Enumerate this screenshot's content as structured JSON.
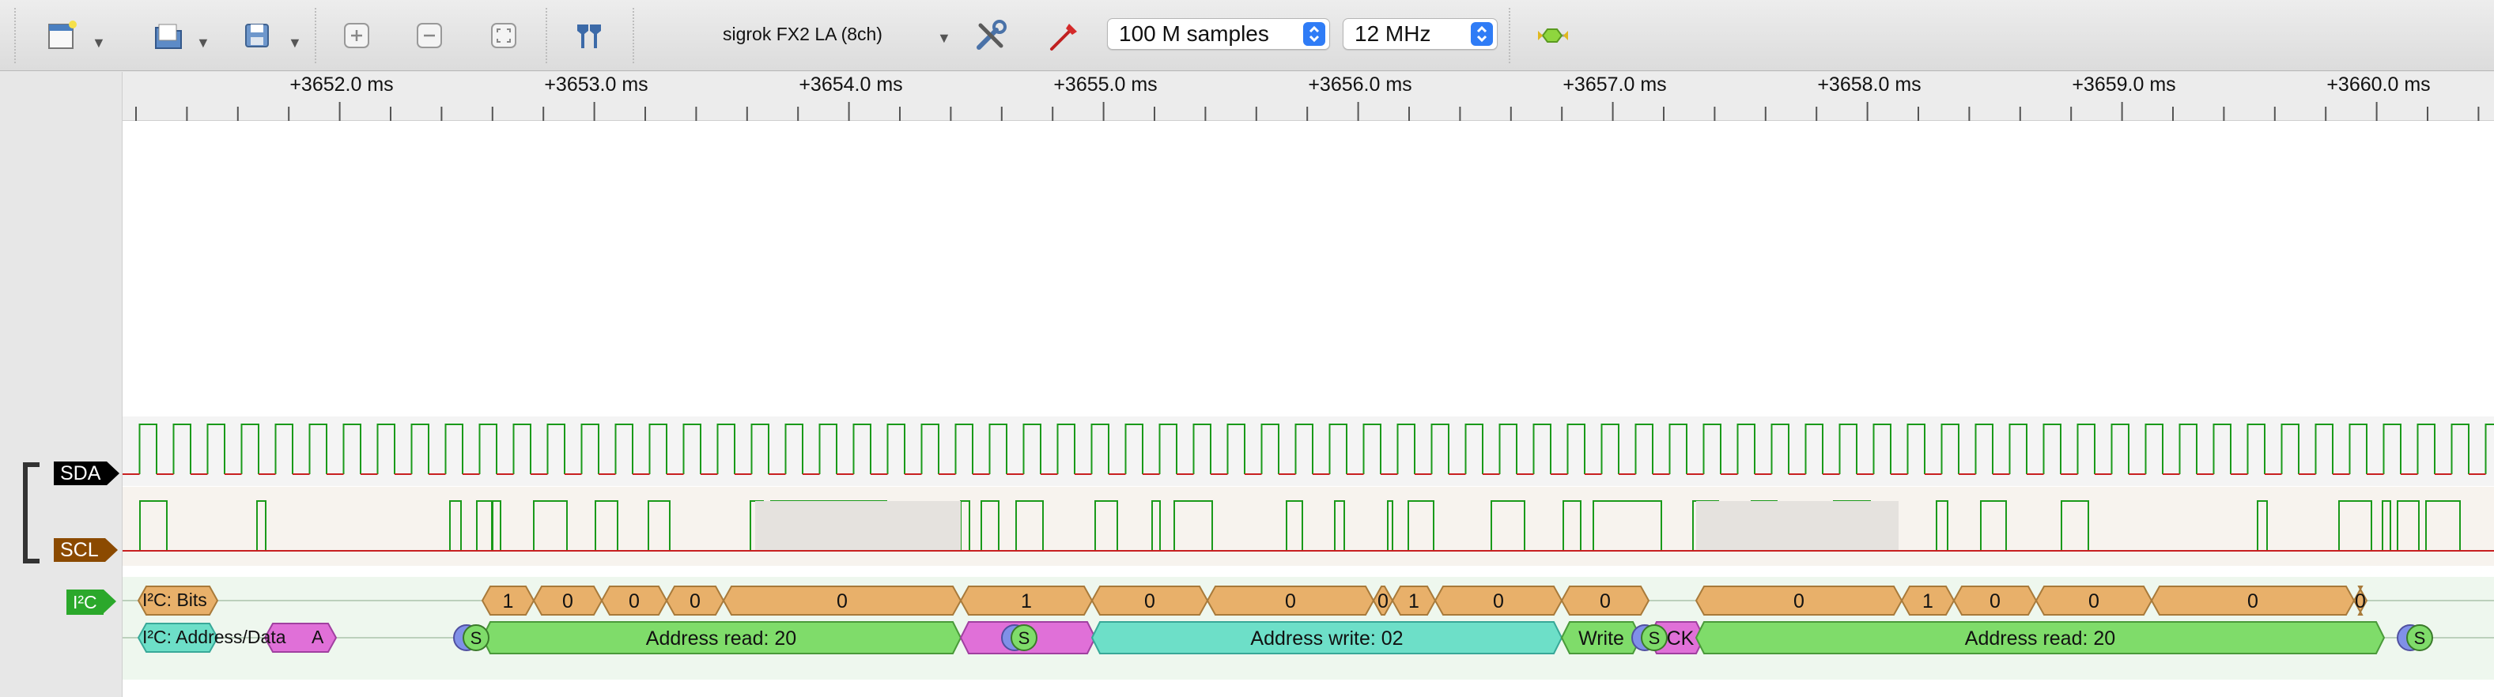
{
  "toolbar": {
    "new_session_icon": "new-document-icon",
    "open_icon": "open-folder-icon",
    "save_icon": "save-icon",
    "zoom_in_icon": "zoom-in-icon",
    "zoom_out_icon": "zoom-out-icon",
    "zoom_fit_icon": "zoom-fit-icon",
    "cursors_icon": "cursors-icon",
    "device": "sigrok FX2 LA (8ch)",
    "config_icon": "tools-icon",
    "probe_icon": "probe-icon",
    "samples": "100 M samples",
    "samplerate": "12 MHz",
    "run_icon": "run-icon"
  },
  "ruler": {
    "ticks": [
      "+3652.0 ms",
      "+3653.0 ms",
      "+3654.0 ms",
      "+3655.0 ms",
      "+3656.0 ms",
      "+3657.0 ms",
      "+3658.0 ms",
      "+3659.0 ms",
      "+3660.0 ms"
    ]
  },
  "channels": {
    "sda": {
      "label": "SDA",
      "color": "#000000",
      "trace_color": "#1a9a1a"
    },
    "scl": {
      "label": "SCL",
      "color": "#8b4a00",
      "trace_color": "#1a9a1a"
    },
    "i2c": {
      "label": "I²C",
      "color": "#2ba82b"
    }
  },
  "decoder_rows": {
    "bits": "I²C: Bits",
    "address_data": "I²C: Address/Data",
    "address_data_badge": "A"
  },
  "annotations": {
    "bits": [
      "1",
      "0",
      "0",
      "0",
      "0",
      "1",
      "0",
      "0",
      "0",
      "1",
      "0",
      "0",
      "0",
      "1",
      "0",
      "0",
      "0",
      "0"
    ],
    "address": [
      "Address read: 20",
      "Address write: 02",
      "Write",
      "Address read: 20"
    ],
    "markers": [
      "S",
      "S",
      "S",
      "S",
      "S",
      "CK"
    ]
  },
  "colors": {
    "bit_fill": "#e8b06a",
    "addr_read": "#7fdc6a",
    "addr_write": "#6ddfc8",
    "ack": "#e070d8",
    "start": "#7fdc6a",
    "repeat": "#8090e8"
  }
}
